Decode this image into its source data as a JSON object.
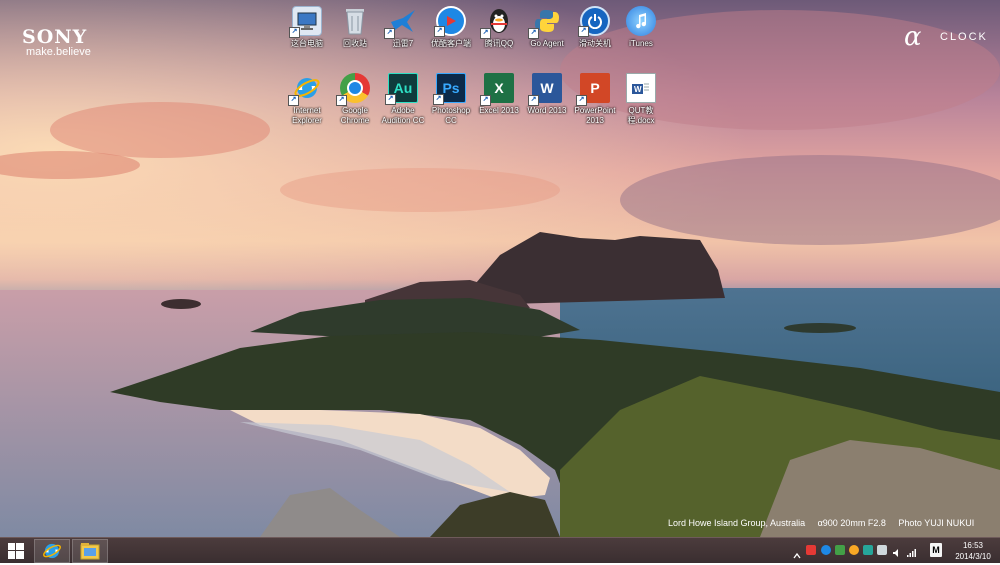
{
  "wallpaper": {
    "brand": "SONY",
    "tagline": "make.believe",
    "alpha_symbol": "α",
    "clock_word": "CLOCK",
    "credit": {
      "location": "Lord Howe Island Group, Australia",
      "camera": "α900  20mm F2.8",
      "photographer": "Photo YUJI NUKUI"
    }
  },
  "desktop_icons": [
    {
      "label": "这台电脑",
      "icon": "computer-icon",
      "color": "#3b78c4"
    },
    {
      "label": "回收站",
      "icon": "recycle-bin-icon",
      "color": "#9aa3ad"
    },
    {
      "label": "迅雷7",
      "icon": "xunlei-bird-icon",
      "color": "#1f7fd6"
    },
    {
      "label": "优酷客户端",
      "icon": "youku-play-icon",
      "color": "#1e88e5"
    },
    {
      "label": "腾讯QQ",
      "icon": "qq-penguin-icon",
      "color": "#222222"
    },
    {
      "label": "Go Agent",
      "icon": "python-icon",
      "color": "#3776ab"
    },
    {
      "label": "滑动关机",
      "icon": "power-icon",
      "color": "#1565c0"
    },
    {
      "label": "iTunes",
      "icon": "itunes-icon",
      "color": "#3d8fe0"
    },
    {
      "label": "Internet Explorer",
      "icon": "ie-icon",
      "color": "#2a9fe8"
    },
    {
      "label": "Google Chrome",
      "icon": "chrome-icon",
      "color": "#e53935"
    },
    {
      "label": "Adobe Audition CC",
      "icon": "audition-icon",
      "color": "#0f3b3c"
    },
    {
      "label": "Photoshop CC",
      "icon": "photoshop-icon",
      "color": "#0b2a4a"
    },
    {
      "label": "Excel 2013",
      "icon": "excel-icon",
      "color": "#1e7145"
    },
    {
      "label": "Word 2013",
      "icon": "word-icon",
      "color": "#2b579a"
    },
    {
      "label": "PowerPoint 2013",
      "icon": "powerpoint-icon",
      "color": "#d24726"
    },
    {
      "label": "QUT教程.docx",
      "icon": "docx-file-icon",
      "color": "#2b579a"
    }
  ],
  "icon_glyphs": {
    "audition": "Au",
    "photoshop": "Ps",
    "excel": "X",
    "word": "W",
    "powerpoint": "P"
  },
  "taskbar": {
    "clock_time": "16:53",
    "clock_date": "2014/3/10",
    "input_indicator": "M"
  }
}
